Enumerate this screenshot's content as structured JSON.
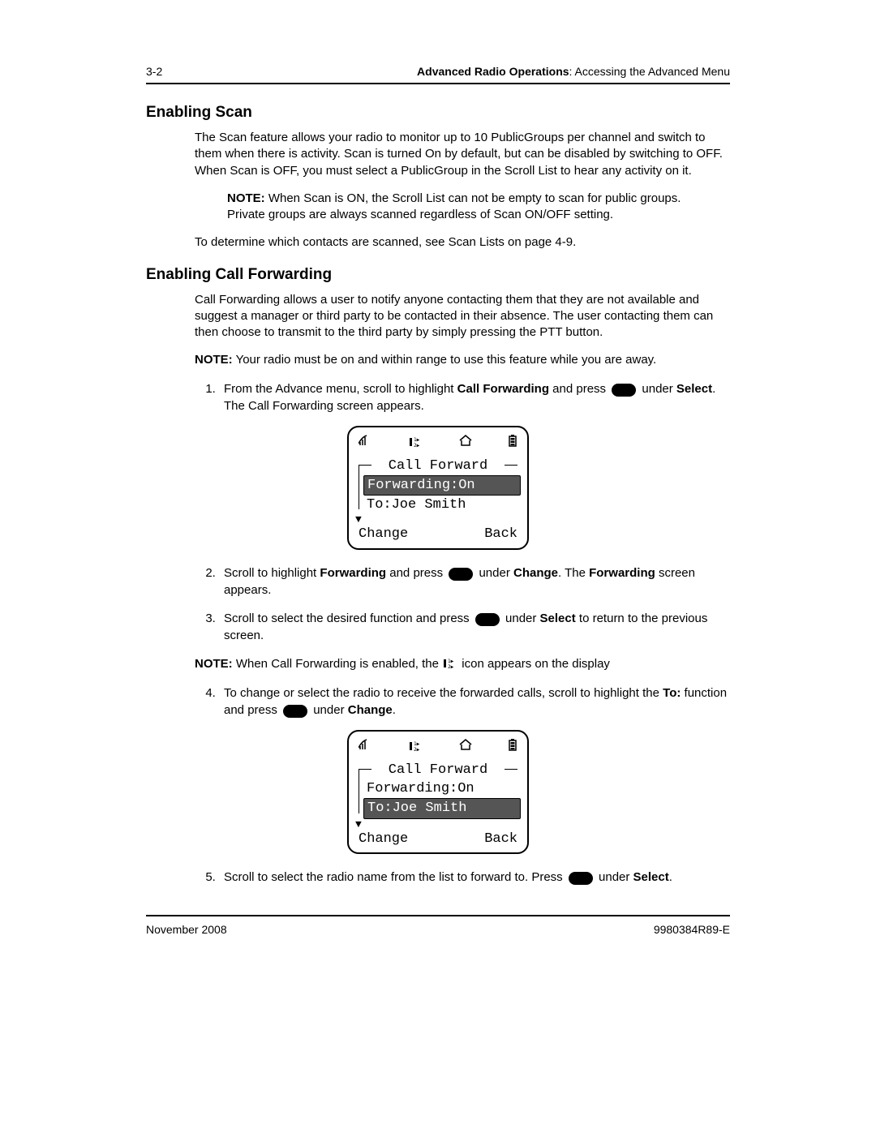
{
  "header": {
    "pagenum": "3-2",
    "chapter_bold": "Advanced Radio Operations",
    "chapter_rest": ": Accessing the Advanced Menu"
  },
  "s1": {
    "title": "Enabling Scan",
    "p1": "The Scan feature allows your radio to monitor up to 10 PublicGroups per channel and switch to them when there is activity. Scan is turned On by default, but can be disabled by switching to OFF. When Scan is OFF, you must select a PublicGroup in the Scroll List to hear any activity on it.",
    "note_label": "NOTE:",
    "note_text": "When Scan is ON, the Scroll List can not be empty to scan for public groups. Private groups are always scanned regardless of Scan ON/OFF setting.",
    "p2": "To determine which contacts are scanned, see Scan Lists on page 4-9."
  },
  "s2": {
    "title": "Enabling Call Forwarding",
    "p1": "Call Forwarding allows a user to notify anyone contacting them that they are not available and suggest a manager or third party to be contacted in their absence. The user contacting them can then choose to transmit to the third party by simply pressing the PTT button.",
    "note1_label": "NOTE:",
    "note1_text": " Your radio must be on and within range to use this feature while you are away.",
    "step1_a": "From the Advance menu, scroll to highlight ",
    "step1_b_bold": "Call Forwarding",
    "step1_c": " and press ",
    "step1_d": " under ",
    "step1_e_bold": "Select",
    "step1_f": ". The Call Forwarding screen appears.",
    "step2_a": "Scroll to highlight ",
    "step2_b_bold": "Forwarding",
    "step2_c": " and press ",
    "step2_d": " under ",
    "step2_e_bold": "Change",
    "step2_f": ". The ",
    "step2_g_bold": "Forwarding",
    "step2_h": " screen appears.",
    "step3_a": "Scroll to select the desired function and press ",
    "step3_b": " under ",
    "step3_c_bold": "Select",
    "step3_d": " to return to the previous screen.",
    "note2_label": "NOTE:",
    "note2_a": " When Call Forwarding is enabled, the ",
    "note2_b": " icon appears on the display",
    "step4_a": "To change or select the radio to receive the forwarded calls, scroll to highlight the ",
    "step4_b_bold": "To:",
    "step4_c": " function and press ",
    "step4_d": " under ",
    "step4_e_bold": "Change",
    "step4_f": ".",
    "step5_a": "Scroll to select the radio name from the list to forward to. Press ",
    "step5_b": " under ",
    "step5_c_bold": "Select",
    "step5_d": "."
  },
  "lcd1": {
    "title": "Call Forward",
    "line1": "Forwarding:On",
    "line2": "To:Joe Smith",
    "soft_left": "Change",
    "soft_right": "Back",
    "selected": 1
  },
  "lcd2": {
    "title": "Call Forward",
    "line1": "Forwarding:On",
    "line2": "To:Joe Smith",
    "soft_left": "Change",
    "soft_right": "Back",
    "selected": 2
  },
  "footer": {
    "left": "November 2008",
    "right": "9980384R89-E"
  }
}
